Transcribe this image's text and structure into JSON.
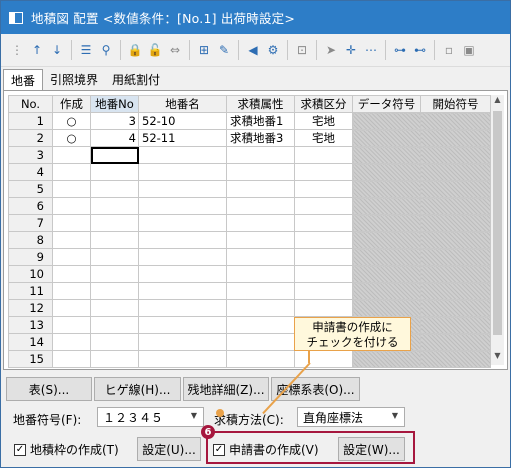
{
  "window": {
    "title": "地積図 配置 <数値条件：[No.1] 出荷時設定>"
  },
  "tabs": [
    "地番",
    "引照境界",
    "用紙割付"
  ],
  "grid": {
    "headers": [
      "No.",
      "作成",
      "地番No",
      "地番名",
      "求積属性",
      "求積区分",
      "データ符号",
      "開始符号"
    ],
    "rows": [
      {
        "no": "1",
        "create": "○",
        "num": "3",
        "name": "52-10",
        "attr": "求積地番1",
        "kubun": "宅地"
      },
      {
        "no": "2",
        "create": "○",
        "num": "4",
        "name": "52-11",
        "attr": "求積地番3",
        "kubun": "宅地"
      },
      {
        "no": "3"
      },
      {
        "no": "4"
      },
      {
        "no": "5"
      },
      {
        "no": "6"
      },
      {
        "no": "7"
      },
      {
        "no": "8"
      },
      {
        "no": "9"
      },
      {
        "no": "10"
      },
      {
        "no": "11"
      },
      {
        "no": "12"
      },
      {
        "no": "13"
      },
      {
        "no": "14"
      },
      {
        "no": "15"
      }
    ]
  },
  "buttons": {
    "table": "表(S)...",
    "leader": "ヒゲ線(H)...",
    "residual": "残地詳細(Z)...",
    "coord": "座標系表(O)...",
    "setting1": "設定(U)...",
    "setting2": "設定(W)..."
  },
  "form": {
    "lot_symbol_label": "地番符号(F):",
    "lot_symbol_value": "１２３４５",
    "method_label": "求積方法(C):",
    "method_value": "直角座標法",
    "frame_check": "地積枠の作成(T)",
    "app_check": "申請書の作成(V)"
  },
  "annotation": {
    "line1": "申請書の作成に",
    "line2": "チェックを付ける",
    "badge": "6"
  }
}
